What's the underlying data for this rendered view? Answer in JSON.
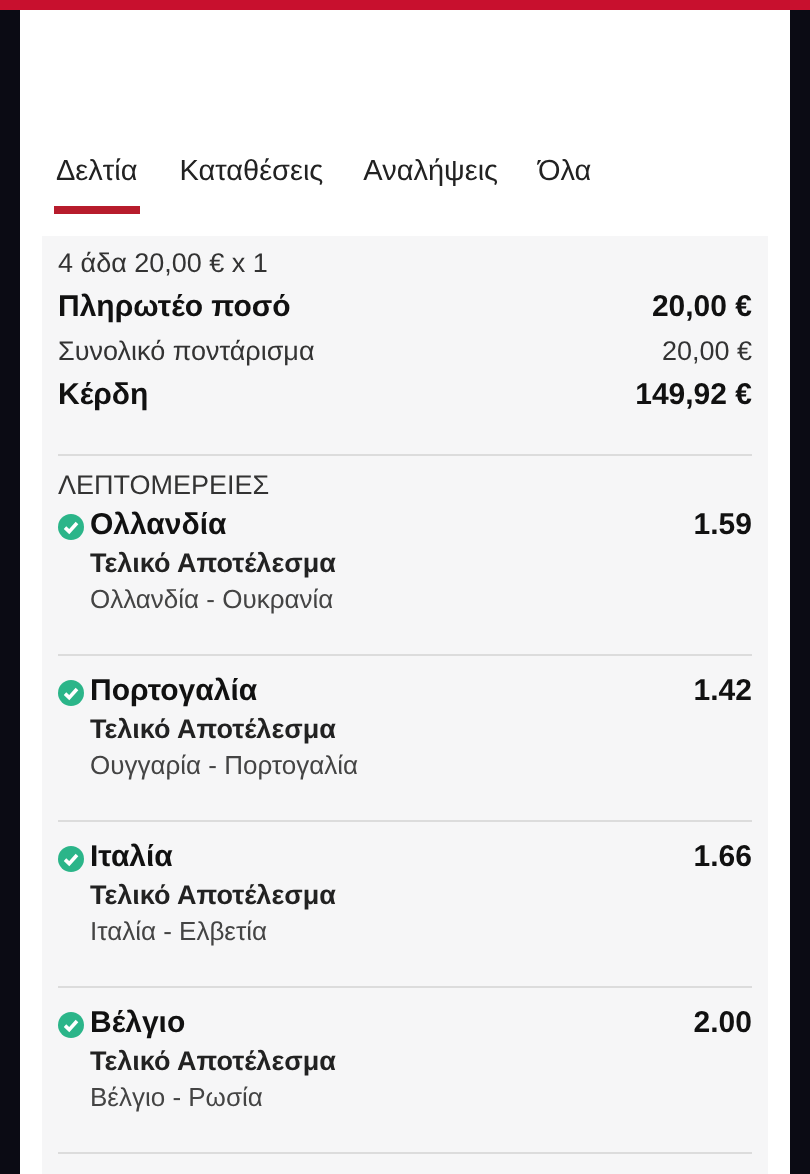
{
  "tabs": [
    {
      "label": "Δελτία",
      "selected": true
    },
    {
      "label": "Καταθέσεις",
      "selected": false
    },
    {
      "label": "Αναλήψεις",
      "selected": false
    },
    {
      "label": "Όλα",
      "selected": false
    }
  ],
  "summary": {
    "bet_type": "4 άδα 20,00 € x 1",
    "rows": [
      {
        "label": "Πληρωτέο ποσό",
        "value": "20,00 €",
        "kind": "bold"
      },
      {
        "label": "Συνολικό ποντάρισμα",
        "value": "20,00 €",
        "kind": "plain"
      },
      {
        "label": "Κέρδη",
        "value": "149,92 €",
        "kind": "bold"
      }
    ]
  },
  "details": {
    "heading": "ΛΕΠΤΟΜΕΡΕΙΕΣ",
    "selections": [
      {
        "pick": "Ολλανδία",
        "odds": "1.59",
        "market": "Τελικό Αποτέλεσμα",
        "event": "Ολλανδία - Ουκρανία",
        "won": true
      },
      {
        "pick": "Πορτογαλία",
        "odds": "1.42",
        "market": "Τελικό Αποτέλεσμα",
        "event": "Ουγγαρία - Πορτογαλία",
        "won": true
      },
      {
        "pick": "Ιταλία",
        "odds": "1.66",
        "market": "Τελικό Αποτέλεσμα",
        "event": "Ιταλία - Ελβετία",
        "won": true
      },
      {
        "pick": "Βέλγιο",
        "odds": "2.00",
        "market": "Τελικό Αποτέλεσμα",
        "event": "Βέλγιο - Ρωσία",
        "won": true
      }
    ]
  }
}
